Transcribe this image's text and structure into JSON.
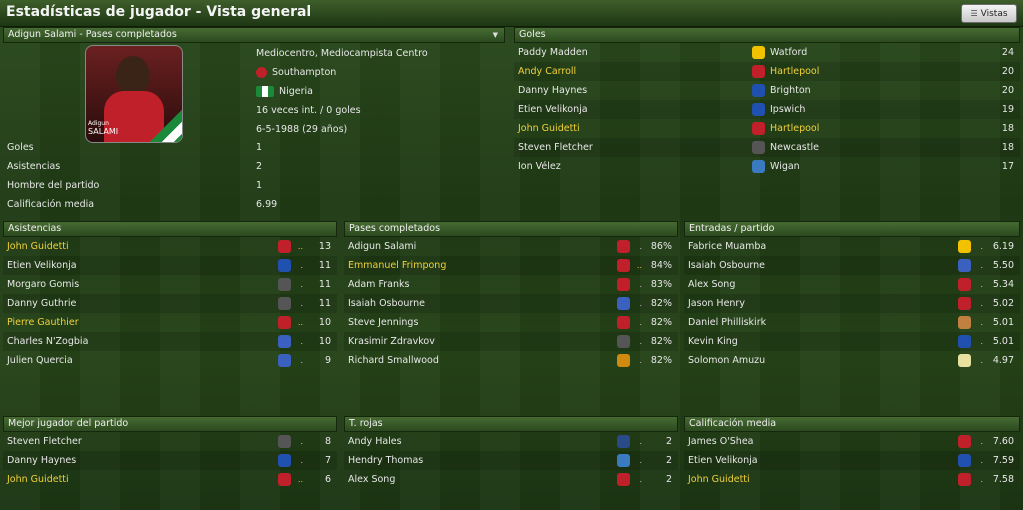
{
  "window": {
    "title": "Estadísticas de jugador - Vista general",
    "views_label": "Vistas"
  },
  "player": {
    "header": "Adigun Salami - Pases completados",
    "photo_name_small": "Adigun",
    "photo_name_big": "SALAMI",
    "position": "Mediocentro, Mediocampista Centro",
    "club": "Southampton",
    "nation": "Nigeria",
    "caps": "16 veces int. / 0 goles",
    "birth": "6-5-1988 (29 años)",
    "stats": [
      {
        "label": "Goles",
        "value": "1"
      },
      {
        "label": "Asistencias",
        "value": "2"
      },
      {
        "label": "Hombre del partido",
        "value": "1"
      },
      {
        "label": "Calificación media",
        "value": "6.99"
      }
    ]
  },
  "goles": {
    "title": "Goles",
    "rows": [
      {
        "name": "Paddy Madden",
        "club": "Watford",
        "value": "24",
        "highlight": false,
        "color": "#f2c200"
      },
      {
        "name": "Andy Carroll",
        "club": "Hartlepool",
        "value": "20",
        "highlight": true,
        "color": "#c0202a"
      },
      {
        "name": "Danny Haynes",
        "club": "Brighton",
        "value": "20",
        "highlight": false,
        "color": "#2050b0"
      },
      {
        "name": "Etien Velikonja",
        "club": "Ipswich",
        "value": "19",
        "highlight": false,
        "color": "#2050b0"
      },
      {
        "name": "John Guidetti",
        "club": "Hartlepool",
        "value": "18",
        "highlight": true,
        "color": "#c0202a"
      },
      {
        "name": "Steven Fletcher",
        "club": "Newcastle",
        "value": "18",
        "highlight": false,
        "color": "#555555"
      },
      {
        "name": "Ion Vélez",
        "club": "Wigan",
        "value": "17",
        "highlight": false,
        "color": "#3a7ac0"
      }
    ]
  },
  "asistencias": {
    "title": "Asistencias",
    "rows": [
      {
        "name": "John Guidetti",
        "value": "13",
        "highlight": true,
        "dots": "..",
        "color": "#c0202a"
      },
      {
        "name": "Etien Velikonja",
        "value": "11",
        "highlight": false,
        "dots": ".",
        "color": "#2050b0"
      },
      {
        "name": "Morgaro Gomis",
        "value": "11",
        "highlight": false,
        "dots": ".",
        "color": "#555555"
      },
      {
        "name": "Danny Guthrie",
        "value": "11",
        "highlight": false,
        "dots": ".",
        "color": "#555555"
      },
      {
        "name": "Pierre Gauthier",
        "value": "10",
        "highlight": true,
        "dots": "..",
        "color": "#c0202a"
      },
      {
        "name": "Charles N'Zogbia",
        "value": "10",
        "highlight": false,
        "dots": ".",
        "color": "#3a60c0"
      },
      {
        "name": "Julien Quercia",
        "value": "9",
        "highlight": false,
        "dots": ".",
        "color": "#3a60c0"
      }
    ]
  },
  "pases": {
    "title": "Pases completados",
    "rows": [
      {
        "name": "Adigun Salami",
        "value": "86%",
        "highlight": false,
        "dots": ".",
        "color": "#c0202a"
      },
      {
        "name": "Emmanuel Frimpong",
        "value": "84%",
        "highlight": true,
        "dots": "..",
        "color": "#c0202a"
      },
      {
        "name": "Adam Franks",
        "value": "83%",
        "highlight": false,
        "dots": ".",
        "color": "#c0202a"
      },
      {
        "name": "Isaiah Osbourne",
        "value": "82%",
        "highlight": false,
        "dots": ".",
        "color": "#3a60c0"
      },
      {
        "name": "Steve Jennings",
        "value": "82%",
        "highlight": false,
        "dots": ".",
        "color": "#c0202a"
      },
      {
        "name": "Krasimir Zdravkov",
        "value": "82%",
        "highlight": false,
        "dots": ".",
        "color": "#555555"
      },
      {
        "name": "Richard Smallwood",
        "value": "82%",
        "highlight": false,
        "dots": ".",
        "color": "#d08a10"
      }
    ]
  },
  "entradas": {
    "title": "Entradas / partido",
    "rows": [
      {
        "name": "Fabrice Muamba",
        "value": "6.19",
        "highlight": false,
        "dots": ".",
        "color": "#f2c200"
      },
      {
        "name": "Isaiah Osbourne",
        "value": "5.50",
        "highlight": false,
        "dots": ".",
        "color": "#3a60c0"
      },
      {
        "name": "Alex Song",
        "value": "5.34",
        "highlight": false,
        "dots": ".",
        "color": "#c0202a"
      },
      {
        "name": "Jason Henry",
        "value": "5.02",
        "highlight": false,
        "dots": ".",
        "color": "#c0202a"
      },
      {
        "name": "Daniel Philliskirk",
        "value": "5.01",
        "highlight": false,
        "dots": ".",
        "color": "#c08040"
      },
      {
        "name": "Kevin King",
        "value": "5.01",
        "highlight": false,
        "dots": ".",
        "color": "#2050b0"
      },
      {
        "name": "Solomon Amuzu",
        "value": "4.97",
        "highlight": false,
        "dots": ".",
        "color": "#e8e0a0"
      }
    ]
  },
  "mejor": {
    "title": "Mejor jugador del partido",
    "rows": [
      {
        "name": "Steven Fletcher",
        "value": "8",
        "highlight": false,
        "dots": ".",
        "color": "#555555"
      },
      {
        "name": "Danny Haynes",
        "value": "7",
        "highlight": false,
        "dots": ".",
        "color": "#2050b0"
      },
      {
        "name": "John Guidetti",
        "value": "6",
        "highlight": true,
        "dots": "..",
        "color": "#c0202a"
      }
    ]
  },
  "rojas": {
    "title": "T. rojas",
    "rows": [
      {
        "name": "Andy Hales",
        "value": "2",
        "highlight": false,
        "dots": ".",
        "color": "#2a4a8a"
      },
      {
        "name": "Hendry Thomas",
        "value": "2",
        "highlight": false,
        "dots": ".",
        "color": "#3a7ac0"
      },
      {
        "name": "Alex Song",
        "value": "2",
        "highlight": false,
        "dots": ".",
        "color": "#c0202a"
      }
    ]
  },
  "calificacion": {
    "title": "Calificación media",
    "rows": [
      {
        "name": "James O'Shea",
        "value": "7.60",
        "highlight": false,
        "dots": ".",
        "color": "#c0202a"
      },
      {
        "name": "Etien Velikonja",
        "value": "7.59",
        "highlight": false,
        "dots": ".",
        "color": "#2050b0"
      },
      {
        "name": "John Guidetti",
        "value": "7.58",
        "highlight": true,
        "dots": ".",
        "color": "#c0202a"
      }
    ]
  }
}
